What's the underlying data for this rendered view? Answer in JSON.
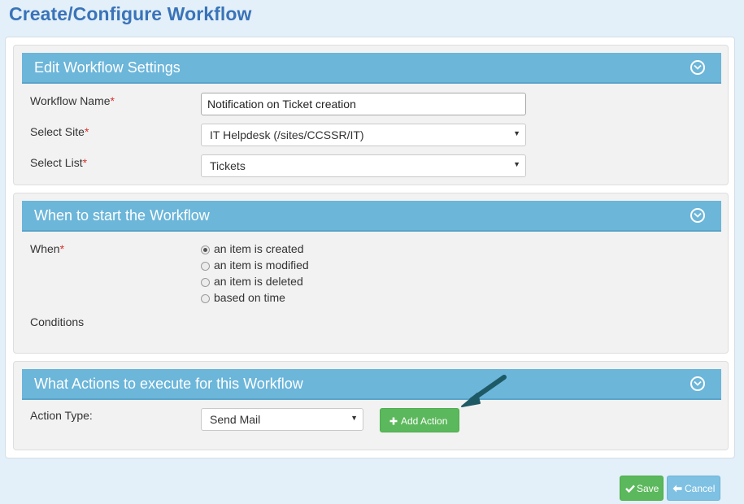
{
  "page": {
    "title": "Create/Configure Workflow"
  },
  "settings_panel": {
    "title": "Edit Workflow Settings",
    "workflow_name": {
      "label": "Workflow Name",
      "value": "Notification on Ticket creation"
    },
    "site": {
      "label": "Select Site",
      "value": "IT Helpdesk (/sites/CCSSR/IT)"
    },
    "list": {
      "label": "Select List",
      "value": "Tickets"
    },
    "required_marker": "*"
  },
  "start_panel": {
    "title": "When to start the Workflow",
    "when_label": "When",
    "options": [
      {
        "label": "an item is created",
        "checked": true
      },
      {
        "label": "an item is modified",
        "checked": false
      },
      {
        "label": "an item is deleted",
        "checked": false
      },
      {
        "label": "based on time",
        "checked": false
      }
    ],
    "conditions_label": "Conditions"
  },
  "actions_panel": {
    "title": "What Actions to execute for this Workflow",
    "action_type_label": "Action Type:",
    "action_type_value": "Send Mail",
    "add_action_label": "Add Action"
  },
  "footer": {
    "save_label": "Save",
    "cancel_label": "Cancel"
  },
  "colors": {
    "title_blue": "#3a73b8",
    "header_blue": "#6cb6da",
    "green_button": "#5cb85c",
    "cancel_button": "#7ec1e3",
    "required_red": "#d9302c",
    "annotation_arrow": "#1e5a66"
  },
  "icons": {
    "collapse": "chevron-circle-down-icon",
    "add": "plus-icon",
    "save": "check-icon",
    "cancel": "arrow-left-icon",
    "dropdown": "caret-down-icon"
  }
}
